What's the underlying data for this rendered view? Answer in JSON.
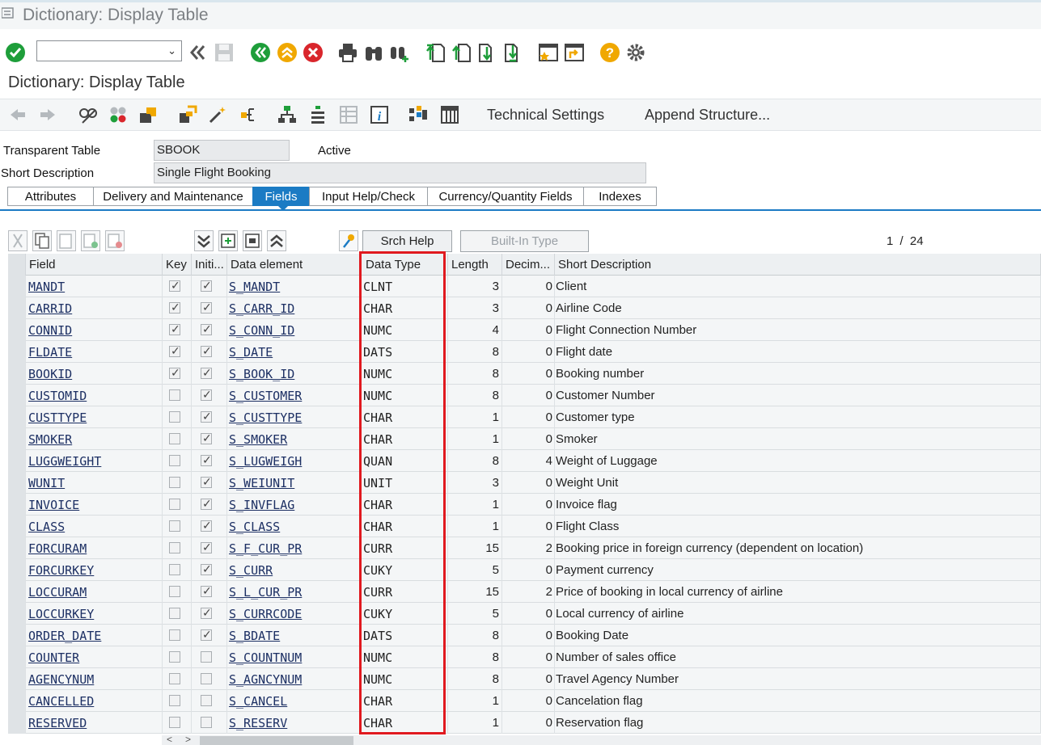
{
  "window": {
    "title": "Dictionary: Display Table"
  },
  "page": {
    "title": "Dictionary: Display Table"
  },
  "app_toolbar": {
    "technical_settings": "Technical Settings",
    "append_structure": "Append Structure..."
  },
  "header": {
    "table_label": "Transparent Table",
    "table_value": "SBOOK",
    "status": "Active",
    "short_desc_label": "Short Description",
    "short_desc_value": "Single Flight Booking"
  },
  "tabs": [
    "Attributes",
    "Delivery and Maintenance",
    "Fields",
    "Input Help/Check",
    "Currency/Quantity Fields",
    "Indexes"
  ],
  "active_tab": "Fields",
  "grid_toolbar": {
    "srch_help": "Srch Help",
    "builtin_type": "Built-In Type",
    "page_current": "1",
    "page_sep": "/",
    "page_total": "24"
  },
  "columns": [
    "Field",
    "Key",
    "Initi...",
    "Data element",
    "Data Type",
    "Length",
    "Decim...",
    "Short Description"
  ],
  "rows": [
    {
      "field": "MANDT",
      "key": true,
      "init": true,
      "de": "S_MANDT",
      "dt": "CLNT",
      "len": "3",
      "dec": "0",
      "desc": "Client"
    },
    {
      "field": "CARRID",
      "key": true,
      "init": true,
      "de": "S_CARR_ID",
      "dt": "CHAR",
      "len": "3",
      "dec": "0",
      "desc": "Airline Code"
    },
    {
      "field": "CONNID",
      "key": true,
      "init": true,
      "de": "S_CONN_ID",
      "dt": "NUMC",
      "len": "4",
      "dec": "0",
      "desc": "Flight Connection Number"
    },
    {
      "field": "FLDATE",
      "key": true,
      "init": true,
      "de": "S_DATE",
      "dt": "DATS",
      "len": "8",
      "dec": "0",
      "desc": "Flight date"
    },
    {
      "field": "BOOKID",
      "key": true,
      "init": true,
      "de": "S_BOOK_ID",
      "dt": "NUMC",
      "len": "8",
      "dec": "0",
      "desc": "Booking number"
    },
    {
      "field": "CUSTOMID",
      "key": false,
      "init": true,
      "de": "S_CUSTOMER",
      "dt": "NUMC",
      "len": "8",
      "dec": "0",
      "desc": "Customer Number"
    },
    {
      "field": "CUSTTYPE",
      "key": false,
      "init": true,
      "de": "S_CUSTTYPE",
      "dt": "CHAR",
      "len": "1",
      "dec": "0",
      "desc": "Customer type"
    },
    {
      "field": "SMOKER",
      "key": false,
      "init": true,
      "de": "S_SMOKER",
      "dt": "CHAR",
      "len": "1",
      "dec": "0",
      "desc": "Smoker"
    },
    {
      "field": "LUGGWEIGHT",
      "key": false,
      "init": true,
      "de": "S_LUGWEIGH",
      "dt": "QUAN",
      "len": "8",
      "dec": "4",
      "desc": "Weight of Luggage"
    },
    {
      "field": "WUNIT",
      "key": false,
      "init": true,
      "de": "S_WEIUNIT",
      "dt": "UNIT",
      "len": "3",
      "dec": "0",
      "desc": "Weight Unit"
    },
    {
      "field": "INVOICE",
      "key": false,
      "init": true,
      "de": "S_INVFLAG",
      "dt": "CHAR",
      "len": "1",
      "dec": "0",
      "desc": "Invoice flag"
    },
    {
      "field": "CLASS",
      "key": false,
      "init": true,
      "de": "S_CLASS",
      "dt": "CHAR",
      "len": "1",
      "dec": "0",
      "desc": "Flight Class"
    },
    {
      "field": "FORCURAM",
      "key": false,
      "init": true,
      "de": "S_F_CUR_PR",
      "dt": "CURR",
      "len": "15",
      "dec": "2",
      "desc": "Booking price in foreign currency (dependent on location)"
    },
    {
      "field": "FORCURKEY",
      "key": false,
      "init": true,
      "de": "S_CURR",
      "dt": "CUKY",
      "len": "5",
      "dec": "0",
      "desc": "Payment currency"
    },
    {
      "field": "LOCCURAM",
      "key": false,
      "init": true,
      "de": "S_L_CUR_PR",
      "dt": "CURR",
      "len": "15",
      "dec": "2",
      "desc": "Price of booking in local currency of airline"
    },
    {
      "field": "LOCCURKEY",
      "key": false,
      "init": true,
      "de": "S_CURRCODE",
      "dt": "CUKY",
      "len": "5",
      "dec": "0",
      "desc": "Local currency of airline"
    },
    {
      "field": "ORDER_DATE",
      "key": false,
      "init": true,
      "de": "S_BDATE",
      "dt": "DATS",
      "len": "8",
      "dec": "0",
      "desc": "Booking Date"
    },
    {
      "field": "COUNTER",
      "key": false,
      "init": false,
      "de": "S_COUNTNUM",
      "dt": "NUMC",
      "len": "8",
      "dec": "0",
      "desc": "Number of sales office"
    },
    {
      "field": "AGENCYNUM",
      "key": false,
      "init": false,
      "de": "S_AGNCYNUM",
      "dt": "NUMC",
      "len": "8",
      "dec": "0",
      "desc": "Travel Agency Number"
    },
    {
      "field": "CANCELLED",
      "key": false,
      "init": false,
      "de": "S_CANCEL",
      "dt": "CHAR",
      "len": "1",
      "dec": "0",
      "desc": "Cancelation flag"
    },
    {
      "field": "RESERVED",
      "key": false,
      "init": false,
      "de": "S_RESERV",
      "dt": "CHAR",
      "len": "1",
      "dec": "0",
      "desc": "Reservation flag"
    }
  ],
  "highlight": {
    "column": "Data Type",
    "color": "#e0191f"
  },
  "colors": {
    "accent": "#1b7bc4",
    "ok_green": "#1e9e3a",
    "cancel_red": "#d9262c",
    "help_yellow": "#f0a800"
  },
  "icons": [
    "menu-icon",
    "enter-check-icon",
    "chevron-down-icon",
    "back-double-left-icon",
    "save-icon",
    "back-green-icon",
    "exit-up-icon",
    "cancel-icon",
    "print-icon",
    "find-icon",
    "find-next-icon",
    "first-page-icon",
    "prev-page-icon",
    "next-page-icon",
    "last-page-icon",
    "new-session-icon",
    "shortcut-icon",
    "help-icon",
    "settings-gear-icon"
  ]
}
